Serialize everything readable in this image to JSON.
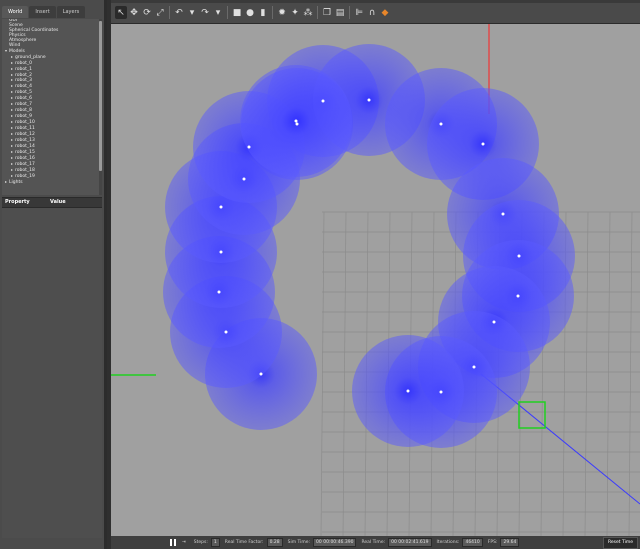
{
  "left_panel": {
    "tabs": [
      {
        "label": "World"
      },
      {
        "label": "Insert"
      },
      {
        "label": "Layers"
      }
    ],
    "tree": [
      {
        "label": "GUI",
        "indent": 0
      },
      {
        "label": "Scene",
        "indent": 0
      },
      {
        "label": "Spherical Coordinates",
        "indent": 0
      },
      {
        "label": "Physics",
        "indent": 0
      },
      {
        "label": "Atmosphere",
        "indent": 0
      },
      {
        "label": "Wind",
        "indent": 0
      },
      {
        "label": "Models",
        "indent": 0,
        "expanded": true
      },
      {
        "label": "ground_plane",
        "indent": 1
      },
      {
        "label": "robot_0",
        "indent": 1
      },
      {
        "label": "robot_1",
        "indent": 1
      },
      {
        "label": "robot_2",
        "indent": 1
      },
      {
        "label": "robot_3",
        "indent": 1
      },
      {
        "label": "robot_4",
        "indent": 1
      },
      {
        "label": "robot_5",
        "indent": 1
      },
      {
        "label": "robot_6",
        "indent": 1
      },
      {
        "label": "robot_7",
        "indent": 1
      },
      {
        "label": "robot_8",
        "indent": 1
      },
      {
        "label": "robot_9",
        "indent": 1
      },
      {
        "label": "robot_10",
        "indent": 1
      },
      {
        "label": "robot_11",
        "indent": 1
      },
      {
        "label": "robot_12",
        "indent": 1
      },
      {
        "label": "robot_13",
        "indent": 1
      },
      {
        "label": "robot_14",
        "indent": 1
      },
      {
        "label": "robot_15",
        "indent": 1
      },
      {
        "label": "robot_16",
        "indent": 1
      },
      {
        "label": "robot_17",
        "indent": 1
      },
      {
        "label": "robot_18",
        "indent": 1
      },
      {
        "label": "robot_19",
        "indent": 1
      },
      {
        "label": "Lights",
        "indent": 0,
        "expanded": false
      }
    ],
    "prop_header": {
      "property": "Property",
      "value": "Value"
    }
  },
  "toolbar": {
    "items": [
      {
        "icon": "select-arrow-icon",
        "glyph": "↖",
        "active": true
      },
      {
        "icon": "translate-icon",
        "glyph": "✥"
      },
      {
        "icon": "rotate-icon",
        "glyph": "⟳"
      },
      {
        "icon": "scale-icon",
        "glyph": "⤢"
      },
      {
        "sep": true
      },
      {
        "icon": "undo-icon",
        "glyph": "↶"
      },
      {
        "icon": "undo-dropdown-icon",
        "glyph": "▾"
      },
      {
        "icon": "redo-icon",
        "glyph": "↷"
      },
      {
        "icon": "redo-dropdown-icon",
        "glyph": "▾"
      },
      {
        "sep": true
      },
      {
        "icon": "box-shape-icon",
        "glyph": "■"
      },
      {
        "icon": "sphere-shape-icon",
        "glyph": "●"
      },
      {
        "icon": "cylinder-shape-icon",
        "glyph": "▮"
      },
      {
        "sep": true
      },
      {
        "icon": "point-light-icon",
        "glyph": "✹"
      },
      {
        "icon": "spot-light-icon",
        "glyph": "✦"
      },
      {
        "icon": "directional-light-icon",
        "glyph": "⁂"
      },
      {
        "sep": true
      },
      {
        "icon": "copy-icon",
        "glyph": "❐"
      },
      {
        "icon": "paste-icon",
        "glyph": "▤"
      },
      {
        "sep": true
      },
      {
        "icon": "align-icon",
        "glyph": "⊫"
      },
      {
        "icon": "snap-icon",
        "glyph": "∩"
      },
      {
        "icon": "screenshot-icon",
        "glyph": "◆",
        "color": "#e8862a"
      }
    ]
  },
  "statusbar": {
    "steps_label": "Steps:",
    "steps_value": "1",
    "rtf_label": "Real Time Factor:",
    "rtf_value": "0.28",
    "sim_label": "Sim Time:",
    "sim_value": "00 00:00:46.390",
    "real_label": "Real Time:",
    "real_value": "00 00:02:41.619",
    "iter_label": "Iterations:",
    "iter_value": "46410",
    "fps_label": "FPS:",
    "fps_value": "29.64",
    "reset_label": "Reset Time"
  },
  "colors": {
    "sensor_fill": "#4b4bff",
    "sensor_center": "#ffffff",
    "grid": "#8b8b8b",
    "axis_x": "#ff2020",
    "axis_y": "#20d020",
    "axis_z": "#3a3aff",
    "selection": "#20d020"
  }
}
